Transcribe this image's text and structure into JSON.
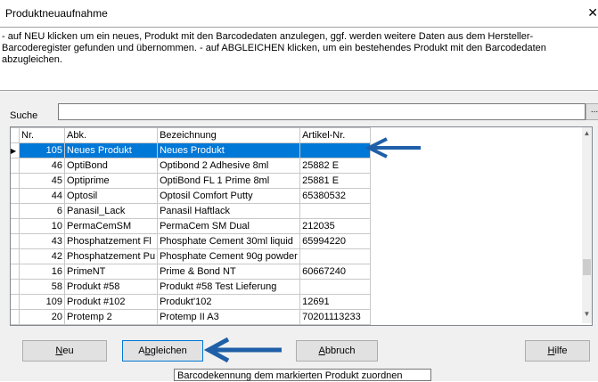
{
  "window": {
    "title": "Produktneuaufnahme",
    "close_glyph": "✕"
  },
  "info": {
    "text": "- auf NEU klicken um ein neues, Produkt mit den Barcodedaten anzulegen, ggf. werden weitere Daten aus dem Hersteller-Barcoderegister gefunden und übernommen. - auf ABGLEICHEN klicken, um ein bestehendes Produkt mit den Barcodedaten abzugleichen."
  },
  "search": {
    "label": "Suche",
    "value": "",
    "button_label": "..."
  },
  "table": {
    "columns": [
      "Nr.",
      "Abk.",
      "Bezeichnung",
      "Artikel-Nr."
    ],
    "rows": [
      {
        "nr": "105",
        "abk": "Neues Produkt",
        "bez": "Neues Produkt",
        "art": ""
      },
      {
        "nr": "46",
        "abk": "OptiBond",
        "bez": "Optibond 2 Adhesive 8ml",
        "art": "25882 E"
      },
      {
        "nr": "45",
        "abk": "Optiprime",
        "bez": "OptiBond FL  1 Prime 8ml",
        "art": "25881 E"
      },
      {
        "nr": "44",
        "abk": "Optosil",
        "bez": "Optosil Comfort Putty",
        "art": "65380532"
      },
      {
        "nr": "6",
        "abk": "Panasil_Lack",
        "bez": "Panasil Haftlack",
        "art": ""
      },
      {
        "nr": "10",
        "abk": "PermaCemSM",
        "bez": "PermaCem SM Dual",
        "art": "212035"
      },
      {
        "nr": "43",
        "abk": "Phosphatzement Fl",
        "bez": "Phosphate Cement  30ml liquid",
        "art": "65994220"
      },
      {
        "nr": "42",
        "abk": "Phosphatzement Pu",
        "bez": "Phosphate Cement 90g powder",
        "art": ""
      },
      {
        "nr": "16",
        "abk": "PrimeNT",
        "bez": "Prime & Bond NT",
        "art": "60667240"
      },
      {
        "nr": "58",
        "abk": "Produkt #58",
        "bez": "Produkt #58 Test Lieferung",
        "art": ""
      },
      {
        "nr": "109",
        "abk": "Produkt #102",
        "bez": "Produkt'102",
        "art": "12691"
      },
      {
        "nr": "20",
        "abk": "Protemp 2",
        "bez": "Protemp II A3",
        "art": "70201113233"
      }
    ],
    "selected_index": 0,
    "row_marker": "▶"
  },
  "buttons": {
    "neu": {
      "pre": "",
      "key": "N",
      "post": "eu"
    },
    "abgleichen": {
      "pre": "A",
      "key": "b",
      "post": "gleichen"
    },
    "abbruch": {
      "pre": "",
      "key": "A",
      "post": "bbruch"
    },
    "hilfe": {
      "pre": "",
      "key": "H",
      "post": "ilfe"
    }
  },
  "tooltip": {
    "text": "Barcodekennung dem markierten Produkt zuordnen"
  },
  "colors": {
    "selection": "#0078d7",
    "arrow": "#1f5fa8"
  },
  "icons": {
    "row_marker": "play-icon",
    "scroll_up": "chevron-up-icon",
    "scroll_down": "chevron-down-icon",
    "arrow": "arrow-left-icon"
  }
}
